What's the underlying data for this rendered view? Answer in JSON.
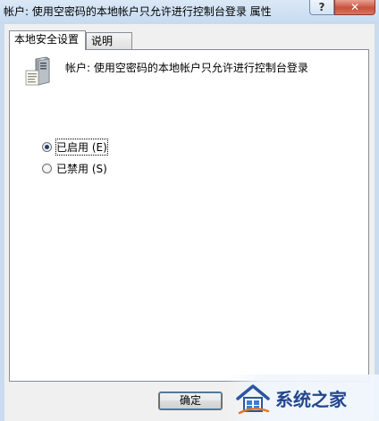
{
  "window": {
    "title": "帐户: 使用空密码的本地帐户只允许进行控制台登录 属性",
    "help_label": "?",
    "close_label": "✕"
  },
  "tabs": [
    {
      "label": "本地安全设置",
      "active": true
    },
    {
      "label": "说明",
      "active": false
    }
  ],
  "policy": {
    "title": "帐户: 使用空密码的本地帐户只允许进行控制台登录",
    "icon": "server-icon"
  },
  "options": [
    {
      "label": "已启用 (E)",
      "checked": true
    },
    {
      "label": "已禁用 (S)",
      "checked": false
    }
  ],
  "buttons": {
    "ok_label": "确定"
  },
  "watermark": {
    "text": "系统之家"
  }
}
